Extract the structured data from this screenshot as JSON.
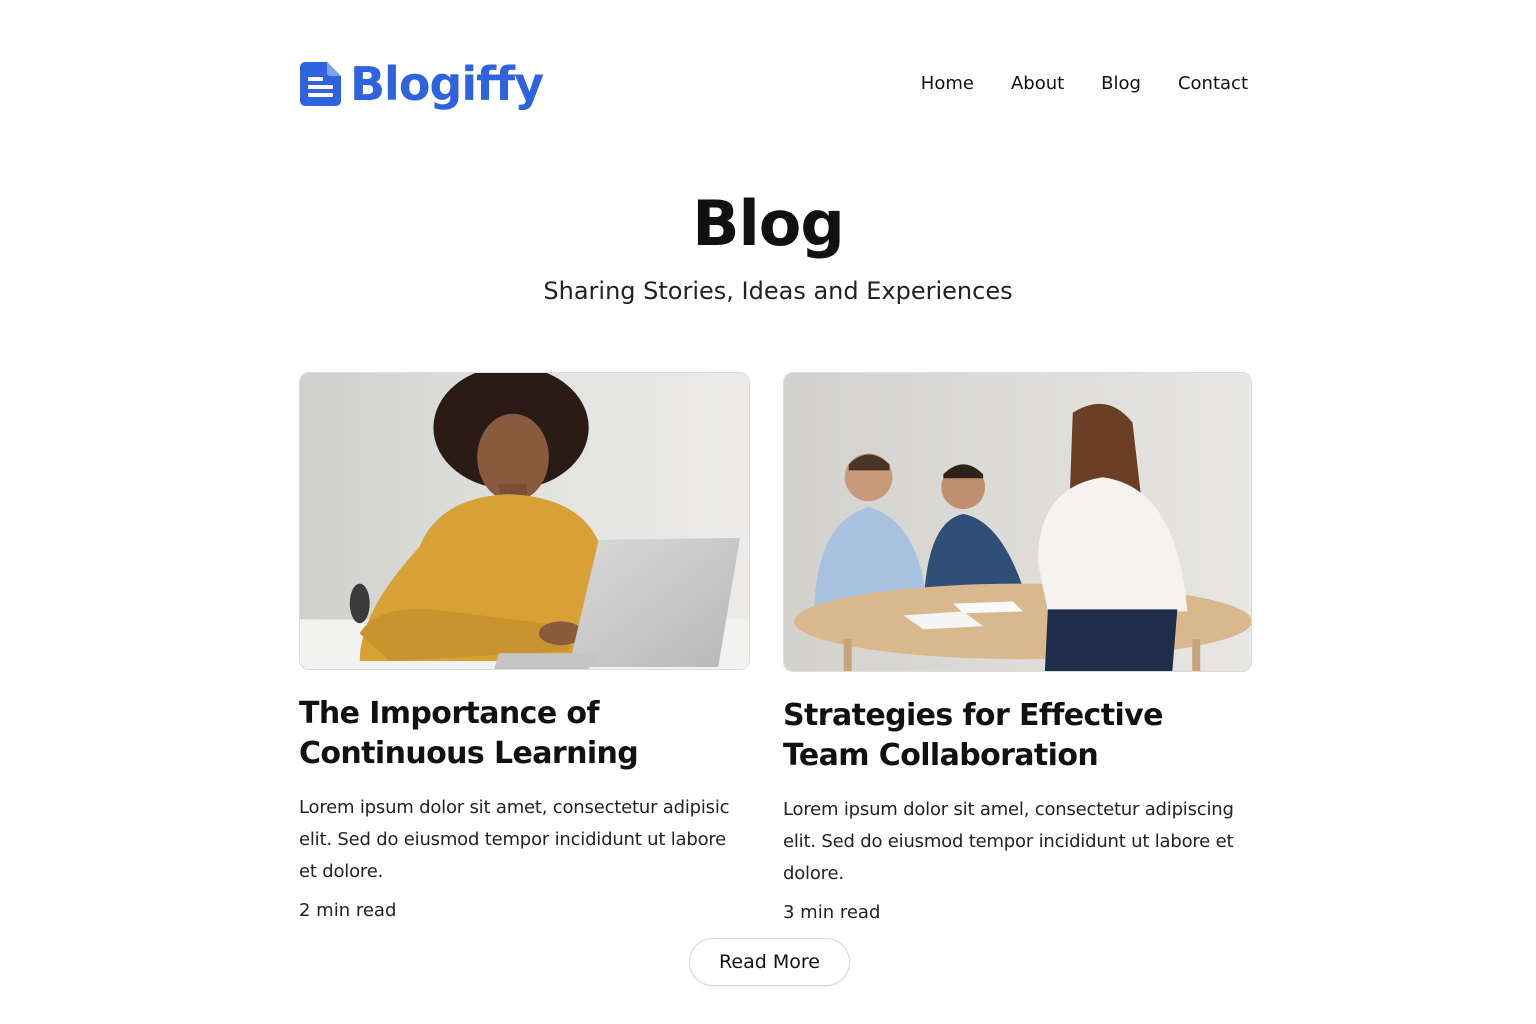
{
  "brand": {
    "name": "Blogiffy",
    "logo_icon": "document-icon",
    "color": "#2f63dd"
  },
  "nav": {
    "items": [
      {
        "label": "Home"
      },
      {
        "label": "About"
      },
      {
        "label": "Blog"
      },
      {
        "label": "Contact"
      }
    ]
  },
  "hero": {
    "title": "Blog",
    "subtitle": "Sharing Stories, Ideas and Experiences"
  },
  "posts": [
    {
      "title": "The Importance of Continuous Learning",
      "excerpt": "Lorem ipsum dolor sit amet, consectetur adipisic elit. Sed do eiusmod tempor incididunt ut labore et dolore.",
      "read_time": "2 min read"
    },
    {
      "title": "Strategies for Effective Team Collaboration",
      "excerpt": "Lorem ipsum dolor sit amel, consectetur adipiscing elit. Sed do eiusmod tempor incididunt ut labore et dolore.",
      "read_time": "3 min read"
    }
  ],
  "actions": {
    "read_more": "Read More"
  }
}
